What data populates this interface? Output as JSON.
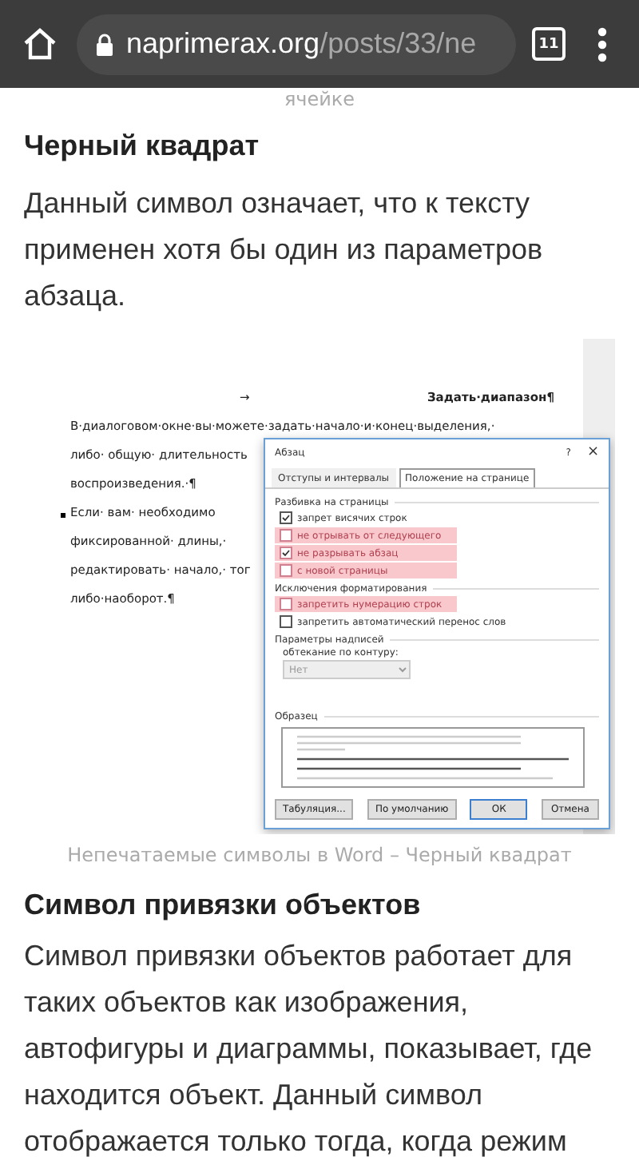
{
  "browser": {
    "url_host": "naprimerax.org",
    "url_path": "/posts/33/ne",
    "tab_count": "11"
  },
  "article": {
    "cut_line": "ячейке",
    "heading_1": "Черный квадрат",
    "paragraph_1": "Данный символ означает, что к тексту применен хотя бы один из параметров абзаца.",
    "figure": {
      "document": {
        "tab_mark": "→",
        "title": "Задать·диапазон¶",
        "lines": [
          {
            "text": "В·диалоговом·окне·вы·можете·задать·начало·и·конец·выделения,·",
            "bullet": false
          },
          {
            "text": "либо· общую· длительность",
            "bullet": false
          },
          {
            "text": "воспроизведения.·¶",
            "bullet": false
          },
          {
            "text": "Если· вам· необходимо",
            "bullet": true
          },
          {
            "text": "фиксированной· длины,·",
            "bullet": false
          },
          {
            "text": "редактировать· начало,· тог",
            "bullet": false
          },
          {
            "text": "либо·наоборот.¶",
            "bullet": false
          }
        ]
      },
      "dialog": {
        "title": "Абзац",
        "help": "?",
        "close": "×",
        "tabs": [
          {
            "label": "Отступы и интервалы",
            "selected": false
          },
          {
            "label": "Положение на странице",
            "selected": true
          }
        ],
        "groups": [
          {
            "title": "Разбивка на страницы",
            "options": [
              {
                "label": "запрет висячих строк",
                "checked": true,
                "highlighted": false
              },
              {
                "label": "не отрывать от следующего",
                "checked": false,
                "highlighted": true
              },
              {
                "label": "не разрывать абзац",
                "checked": true,
                "highlighted": true
              },
              {
                "label": "с новой страницы",
                "checked": false,
                "highlighted": true
              }
            ]
          },
          {
            "title": "Исключения форматирования",
            "options": [
              {
                "label": "запретить нумерацию строк",
                "checked": false,
                "highlighted": true
              },
              {
                "label": "запретить автоматический перенос слов",
                "checked": false,
                "highlighted": false
              }
            ]
          }
        ],
        "textbox_group": {
          "title": "Параметры надписей",
          "field_label": "обтекание по контуру:",
          "value": "Нет",
          "disabled": true
        },
        "preview_title": "Образец",
        "buttons": [
          "Табуляция...",
          "По умолчанию",
          "ОК",
          "Отмена"
        ]
      },
      "caption": "Непечатаемые символы в Word – Черный квадрат"
    },
    "heading_2": "Символ привязки объектов",
    "paragraph_2": "Символ привязки объектов работает для таких объектов как изображения, автофигуры и диаграммы, показывает, где находится объект. Данный символ отображается только тогда, когда режим"
  }
}
